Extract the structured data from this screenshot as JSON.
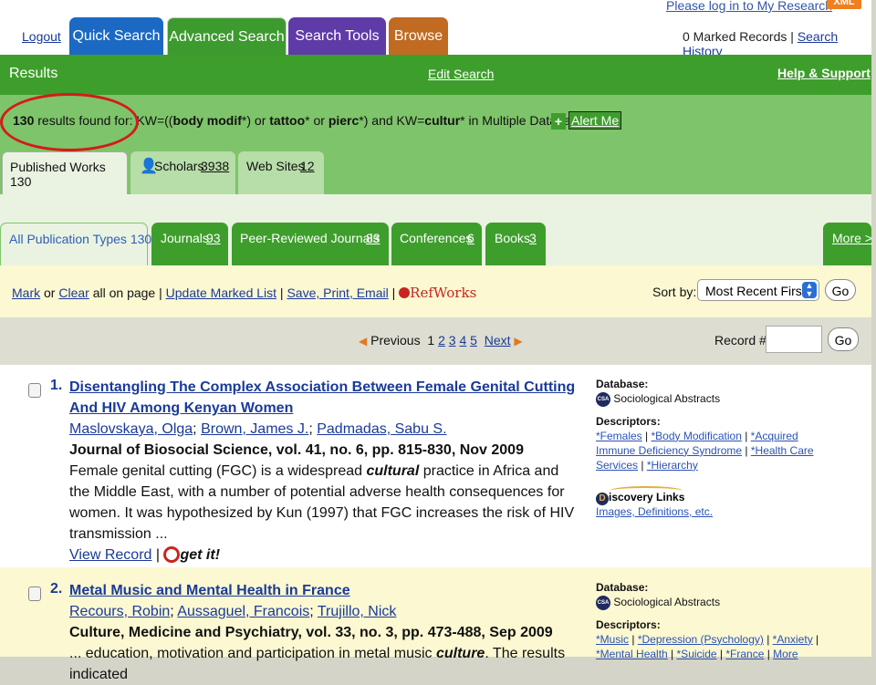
{
  "header": {
    "login_link": "Please log in to My Research",
    "xml_badge": "XML",
    "logout": "Logout",
    "tabs": [
      "Quick Search",
      "Advanced Search",
      "Search Tools",
      "Browse"
    ],
    "marked_records": "0 Marked Records",
    "search_history": "Search History"
  },
  "results_bar": {
    "title": "Results",
    "edit_search": "Edit Search",
    "help": "Help & Support"
  },
  "summary": {
    "count": "130",
    "text_prefix": " results found for: KW=((",
    "term1": "body modif",
    "text_mid1": "*) or ",
    "term2": "tattoo",
    "text_mid2": "* or ",
    "term3": "pierc",
    "text_mid3": "*) and KW=",
    "term4": "cultur",
    "text_suffix": "* in Multiple Databases",
    "alert_plus": "+",
    "alert_me": "Alert Me"
  },
  "work_tabs": {
    "published": "Published Works 130",
    "scholars_label": "Scholars",
    "scholars_count": "3938",
    "websites_label": "Web Sites",
    "websites_count": "12"
  },
  "filter_tabs": {
    "all": "All Publication Types 130",
    "journals_label": "Journals",
    "journals_count": "93",
    "peer_label": "Peer-Reviewed Journals",
    "peer_count": "83",
    "conf_label": "Conferences",
    "conf_count": "6",
    "books_label": "Books",
    "books_count": "3",
    "more": "More >"
  },
  "mark_bar": {
    "mark": "Mark",
    "or": " or ",
    "clear": "Clear",
    "all_on_page": " all on page | ",
    "update": "Update Marked List",
    "sep1": " | ",
    "save": "Save, Print, Email",
    "sep2": " | ",
    "refworks": "RefWorks",
    "sort_label": "Sort by:",
    "sort_value": "Most Recent First",
    "go": "Go"
  },
  "paging": {
    "previous": "Previous",
    "current": "1",
    "pages": [
      "2",
      "3",
      "4",
      "5"
    ],
    "next": "Next",
    "record_label": "Record #",
    "go": "Go"
  },
  "results": [
    {
      "num": "1.",
      "title": "Disentangling The Complex Association Between Female Genital Cutting And HIV Among Kenyan Women",
      "authors": [
        "Maslovskaya, Olga",
        "Brown, James J.",
        "Padmadas, Sabu S."
      ],
      "source": "Journal of Biosocial Science, vol. 41, no. 6, pp. 815-830, Nov 2009",
      "abstract_pre": "Female genital cutting (FGC) is a widespread ",
      "abstract_em": "cultural",
      "abstract_post": " practice in Africa and the Middle East, with a number of potential adverse health consequences for women. It was hypothesized by Kun (1997) that FGC increases the risk of HIV transmission ...",
      "view_record": "View Record",
      "sep": " | ",
      "getit": "get it!",
      "database_label": "Database:",
      "database_icon": "CSA",
      "database": "Sociological Abstracts",
      "descriptors_label": "Descriptors:",
      "descriptors": [
        "*Females",
        "*Body Modification",
        "*Acquired Immune Deficiency Syndrome",
        "*Health Care Services",
        "*Hierarchy"
      ],
      "discovery_label": "iscovery Links",
      "discovery_d": "D",
      "discovery_link": "Images, Definitions, etc."
    },
    {
      "num": "2.",
      "title": "Metal Music and Mental Health in France",
      "authors": [
        "Recours, Robin",
        "Aussaguel, Francois",
        "Trujillo, Nick"
      ],
      "source": "Culture, Medicine and Psychiatry, vol. 33, no. 3, pp. 473-488, Sep 2009",
      "abstract_pre": "... education, motivation and participation in metal music ",
      "abstract_em": "culture",
      "abstract_post": ". The results indicated",
      "database_label": "Database:",
      "database_icon": "CSA",
      "database": "Sociological Abstracts",
      "descriptors_label": "Descriptors:",
      "descriptors": [
        "*Music",
        "*Depression (Psychology)",
        "*Anxiety",
        "*Mental Health",
        "*Suicide",
        "*France",
        "More"
      ]
    }
  ],
  "colors": {
    "green_dark": "#3e9e2c",
    "green_light": "#7ec46a",
    "quick_tab": "#1c69c4",
    "tools_tab": "#5f3ba8",
    "browse_tab": "#c06a22",
    "highlight_oval": "#d41a1a"
  }
}
